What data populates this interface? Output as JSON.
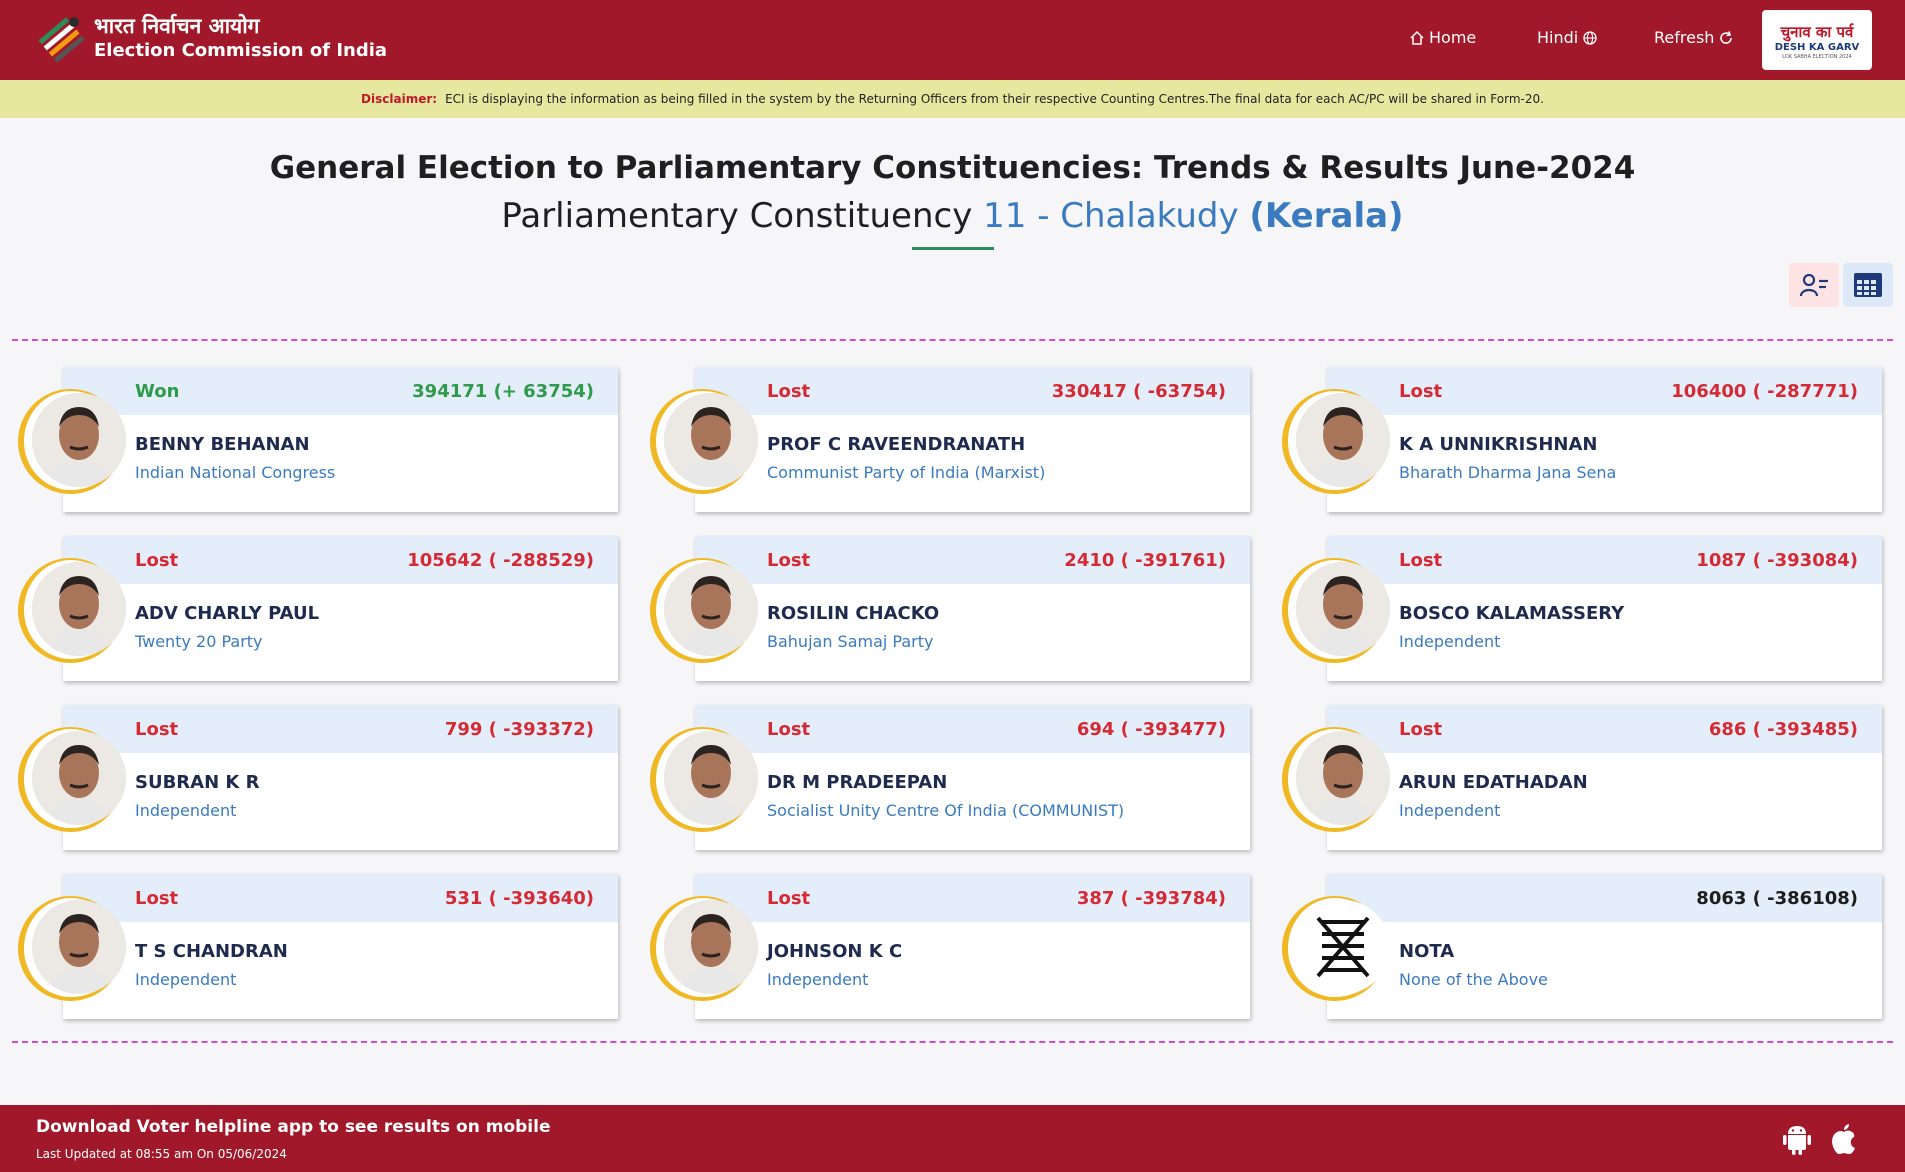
{
  "header": {
    "logo_hindi": "भारत निर्वाचन आयोग",
    "logo_english": "Election Commission of India",
    "nav": {
      "home": "Home",
      "hindi": "Hindi",
      "refresh": "Refresh"
    },
    "badge": {
      "hindi": "चुनाव का पर्व",
      "english": "DESH KA GARV",
      "tiny": "LOK SABHA ELECTION 2024"
    }
  },
  "disclaimer": {
    "label": "Disclaimer:",
    "text": "ECI is displaying the information as being filled in the system by the Returning Officers from their respective Counting Centres.The final data for each AC/PC will be shared in Form-20."
  },
  "title": {
    "line1": "General Election to Parliamentary Constituencies: Trends & Results June-2024",
    "line2_prefix": "Parliamentary Constituency",
    "pc": "11 - Chalakudy",
    "state": "(Kerala)"
  },
  "candidates": [
    {
      "status": "Won",
      "votes": "394171 (+ 63754)",
      "name": "BENNY BEHANAN",
      "party": "Indian National Congress"
    },
    {
      "status": "Lost",
      "votes": "330417 ( -63754)",
      "name": "PROF C RAVEENDRANATH",
      "party": "Communist Party of India (Marxist)"
    },
    {
      "status": "Lost",
      "votes": "106400 ( -287771)",
      "name": "K A UNNIKRISHNAN",
      "party": "Bharath Dharma Jana Sena"
    },
    {
      "status": "Lost",
      "votes": "105642 ( -288529)",
      "name": "ADV CHARLY PAUL",
      "party": "Twenty 20 Party"
    },
    {
      "status": "Lost",
      "votes": "2410 ( -391761)",
      "name": "ROSILIN CHACKO",
      "party": "Bahujan Samaj Party"
    },
    {
      "status": "Lost",
      "votes": "1087 ( -393084)",
      "name": "BOSCO KALAMASSERY",
      "party": "Independent"
    },
    {
      "status": "Lost",
      "votes": "799 ( -393372)",
      "name": "SUBRAN K R",
      "party": "Independent"
    },
    {
      "status": "Lost",
      "votes": "694 ( -393477)",
      "name": "DR M PRADEEPAN",
      "party": "Socialist Unity Centre Of India (COMMUNIST)"
    },
    {
      "status": "Lost",
      "votes": "686 ( -393485)",
      "name": "ARUN EDATHADAN",
      "party": "Independent"
    },
    {
      "status": "Lost",
      "votes": "531 ( -393640)",
      "name": "T S CHANDRAN",
      "party": "Independent"
    },
    {
      "status": "Lost",
      "votes": "387 ( -393784)",
      "name": "JOHNSON K C",
      "party": "Independent"
    },
    {
      "status": "",
      "votes": "8063 ( -386108)",
      "name": "NOTA",
      "party": "None of the Above"
    }
  ],
  "footer": {
    "main": "Download Voter helpline app to see results on mobile",
    "updated": "Last Updated at 08:55 am On 05/06/2024"
  },
  "colors": {
    "brand": "#a0182a",
    "won": "#2e9a4a",
    "lost": "#d42a34",
    "link": "#3a7abf",
    "ring": "#f0b823"
  }
}
